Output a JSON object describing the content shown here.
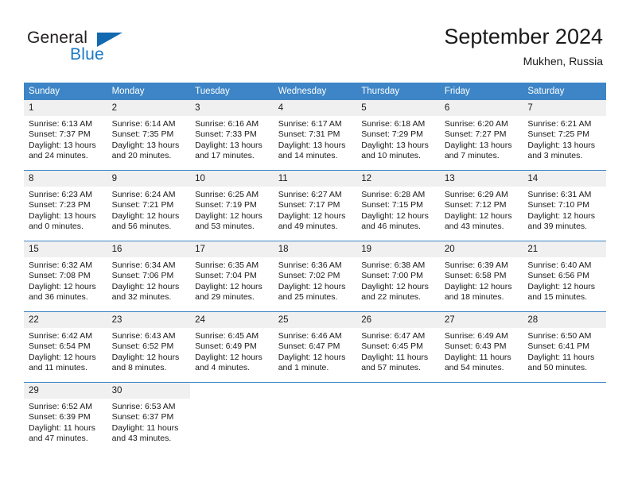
{
  "brand": {
    "name_part1": "General",
    "name_part2": "Blue",
    "logo_icon": "triangle-flag-icon"
  },
  "header": {
    "title": "September 2024",
    "location": "Mukhen, Russia"
  },
  "calendar": {
    "weekday_headers": [
      "Sunday",
      "Monday",
      "Tuesday",
      "Wednesday",
      "Thursday",
      "Friday",
      "Saturday"
    ],
    "accent_color": "#3d85c6",
    "daynum_background": "#f0f0f0",
    "weeks": [
      [
        {
          "day": "1",
          "sunrise": "Sunrise: 6:13 AM",
          "sunset": "Sunset: 7:37 PM",
          "daylight_line1": "Daylight: 13 hours",
          "daylight_line2": "and 24 minutes."
        },
        {
          "day": "2",
          "sunrise": "Sunrise: 6:14 AM",
          "sunset": "Sunset: 7:35 PM",
          "daylight_line1": "Daylight: 13 hours",
          "daylight_line2": "and 20 minutes."
        },
        {
          "day": "3",
          "sunrise": "Sunrise: 6:16 AM",
          "sunset": "Sunset: 7:33 PM",
          "daylight_line1": "Daylight: 13 hours",
          "daylight_line2": "and 17 minutes."
        },
        {
          "day": "4",
          "sunrise": "Sunrise: 6:17 AM",
          "sunset": "Sunset: 7:31 PM",
          "daylight_line1": "Daylight: 13 hours",
          "daylight_line2": "and 14 minutes."
        },
        {
          "day": "5",
          "sunrise": "Sunrise: 6:18 AM",
          "sunset": "Sunset: 7:29 PM",
          "daylight_line1": "Daylight: 13 hours",
          "daylight_line2": "and 10 minutes."
        },
        {
          "day": "6",
          "sunrise": "Sunrise: 6:20 AM",
          "sunset": "Sunset: 7:27 PM",
          "daylight_line1": "Daylight: 13 hours",
          "daylight_line2": "and 7 minutes."
        },
        {
          "day": "7",
          "sunrise": "Sunrise: 6:21 AM",
          "sunset": "Sunset: 7:25 PM",
          "daylight_line1": "Daylight: 13 hours",
          "daylight_line2": "and 3 minutes."
        }
      ],
      [
        {
          "day": "8",
          "sunrise": "Sunrise: 6:23 AM",
          "sunset": "Sunset: 7:23 PM",
          "daylight_line1": "Daylight: 13 hours",
          "daylight_line2": "and 0 minutes."
        },
        {
          "day": "9",
          "sunrise": "Sunrise: 6:24 AM",
          "sunset": "Sunset: 7:21 PM",
          "daylight_line1": "Daylight: 12 hours",
          "daylight_line2": "and 56 minutes."
        },
        {
          "day": "10",
          "sunrise": "Sunrise: 6:25 AM",
          "sunset": "Sunset: 7:19 PM",
          "daylight_line1": "Daylight: 12 hours",
          "daylight_line2": "and 53 minutes."
        },
        {
          "day": "11",
          "sunrise": "Sunrise: 6:27 AM",
          "sunset": "Sunset: 7:17 PM",
          "daylight_line1": "Daylight: 12 hours",
          "daylight_line2": "and 49 minutes."
        },
        {
          "day": "12",
          "sunrise": "Sunrise: 6:28 AM",
          "sunset": "Sunset: 7:15 PM",
          "daylight_line1": "Daylight: 12 hours",
          "daylight_line2": "and 46 minutes."
        },
        {
          "day": "13",
          "sunrise": "Sunrise: 6:29 AM",
          "sunset": "Sunset: 7:12 PM",
          "daylight_line1": "Daylight: 12 hours",
          "daylight_line2": "and 43 minutes."
        },
        {
          "day": "14",
          "sunrise": "Sunrise: 6:31 AM",
          "sunset": "Sunset: 7:10 PM",
          "daylight_line1": "Daylight: 12 hours",
          "daylight_line2": "and 39 minutes."
        }
      ],
      [
        {
          "day": "15",
          "sunrise": "Sunrise: 6:32 AM",
          "sunset": "Sunset: 7:08 PM",
          "daylight_line1": "Daylight: 12 hours",
          "daylight_line2": "and 36 minutes."
        },
        {
          "day": "16",
          "sunrise": "Sunrise: 6:34 AM",
          "sunset": "Sunset: 7:06 PM",
          "daylight_line1": "Daylight: 12 hours",
          "daylight_line2": "and 32 minutes."
        },
        {
          "day": "17",
          "sunrise": "Sunrise: 6:35 AM",
          "sunset": "Sunset: 7:04 PM",
          "daylight_line1": "Daylight: 12 hours",
          "daylight_line2": "and 29 minutes."
        },
        {
          "day": "18",
          "sunrise": "Sunrise: 6:36 AM",
          "sunset": "Sunset: 7:02 PM",
          "daylight_line1": "Daylight: 12 hours",
          "daylight_line2": "and 25 minutes."
        },
        {
          "day": "19",
          "sunrise": "Sunrise: 6:38 AM",
          "sunset": "Sunset: 7:00 PM",
          "daylight_line1": "Daylight: 12 hours",
          "daylight_line2": "and 22 minutes."
        },
        {
          "day": "20",
          "sunrise": "Sunrise: 6:39 AM",
          "sunset": "Sunset: 6:58 PM",
          "daylight_line1": "Daylight: 12 hours",
          "daylight_line2": "and 18 minutes."
        },
        {
          "day": "21",
          "sunrise": "Sunrise: 6:40 AM",
          "sunset": "Sunset: 6:56 PM",
          "daylight_line1": "Daylight: 12 hours",
          "daylight_line2": "and 15 minutes."
        }
      ],
      [
        {
          "day": "22",
          "sunrise": "Sunrise: 6:42 AM",
          "sunset": "Sunset: 6:54 PM",
          "daylight_line1": "Daylight: 12 hours",
          "daylight_line2": "and 11 minutes."
        },
        {
          "day": "23",
          "sunrise": "Sunrise: 6:43 AM",
          "sunset": "Sunset: 6:52 PM",
          "daylight_line1": "Daylight: 12 hours",
          "daylight_line2": "and 8 minutes."
        },
        {
          "day": "24",
          "sunrise": "Sunrise: 6:45 AM",
          "sunset": "Sunset: 6:49 PM",
          "daylight_line1": "Daylight: 12 hours",
          "daylight_line2": "and 4 minutes."
        },
        {
          "day": "25",
          "sunrise": "Sunrise: 6:46 AM",
          "sunset": "Sunset: 6:47 PM",
          "daylight_line1": "Daylight: 12 hours",
          "daylight_line2": "and 1 minute."
        },
        {
          "day": "26",
          "sunrise": "Sunrise: 6:47 AM",
          "sunset": "Sunset: 6:45 PM",
          "daylight_line1": "Daylight: 11 hours",
          "daylight_line2": "and 57 minutes."
        },
        {
          "day": "27",
          "sunrise": "Sunrise: 6:49 AM",
          "sunset": "Sunset: 6:43 PM",
          "daylight_line1": "Daylight: 11 hours",
          "daylight_line2": "and 54 minutes."
        },
        {
          "day": "28",
          "sunrise": "Sunrise: 6:50 AM",
          "sunset": "Sunset: 6:41 PM",
          "daylight_line1": "Daylight: 11 hours",
          "daylight_line2": "and 50 minutes."
        }
      ],
      [
        {
          "day": "29",
          "sunrise": "Sunrise: 6:52 AM",
          "sunset": "Sunset: 6:39 PM",
          "daylight_line1": "Daylight: 11 hours",
          "daylight_line2": "and 47 minutes."
        },
        {
          "day": "30",
          "sunrise": "Sunrise: 6:53 AM",
          "sunset": "Sunset: 6:37 PM",
          "daylight_line1": "Daylight: 11 hours",
          "daylight_line2": "and 43 minutes."
        },
        {
          "day": "",
          "sunrise": "",
          "sunset": "",
          "daylight_line1": "",
          "daylight_line2": ""
        },
        {
          "day": "",
          "sunrise": "",
          "sunset": "",
          "daylight_line1": "",
          "daylight_line2": ""
        },
        {
          "day": "",
          "sunrise": "",
          "sunset": "",
          "daylight_line1": "",
          "daylight_line2": ""
        },
        {
          "day": "",
          "sunrise": "",
          "sunset": "",
          "daylight_line1": "",
          "daylight_line2": ""
        },
        {
          "day": "",
          "sunrise": "",
          "sunset": "",
          "daylight_line1": "",
          "daylight_line2": ""
        }
      ]
    ]
  }
}
